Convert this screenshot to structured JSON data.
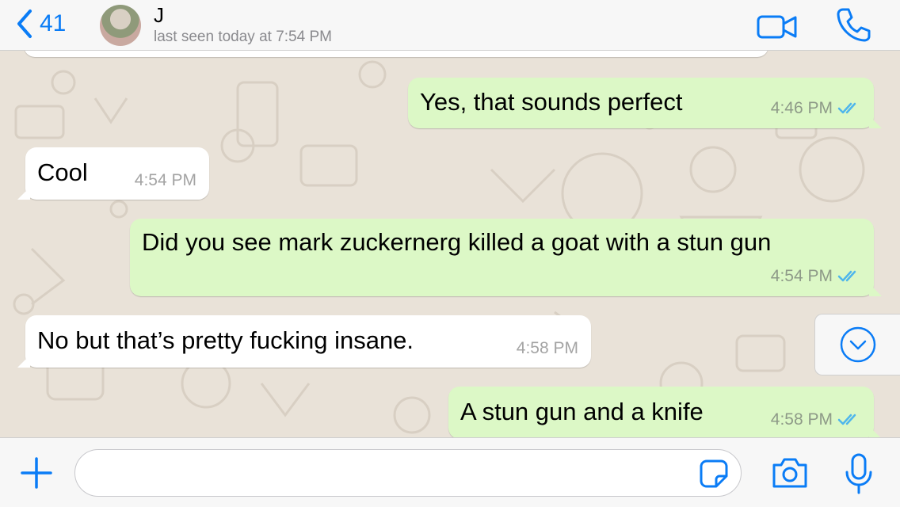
{
  "header": {
    "back_count": "41",
    "contact_name": "J",
    "last_seen": "last seen today at 7:54 PM"
  },
  "messages": [
    {
      "direction": "out",
      "text": "Yes, that sounds perfect",
      "time": "4:46 PM",
      "status": "read"
    },
    {
      "direction": "in",
      "text": "Cool",
      "time": "4:54 PM"
    },
    {
      "direction": "out",
      "text": "Did you see mark zuckernerg killed a goat with a stun gun",
      "time": "4:54 PM",
      "status": "read"
    },
    {
      "direction": "in",
      "text": "No but that’s pretty fucking insane.",
      "time": "4:58 PM"
    },
    {
      "direction": "out",
      "text": "A stun gun and a knife",
      "time": "4:58 PM",
      "status": "read"
    }
  ],
  "composer": {
    "message_value": "",
    "message_placeholder": ""
  },
  "icons": {
    "back": "chevron-left-icon",
    "video": "video-call-icon",
    "phone": "phone-icon",
    "scroll": "chevron-down-circle-icon",
    "plus": "plus-icon",
    "sticker": "sticker-icon",
    "camera": "camera-icon",
    "mic": "microphone-icon"
  },
  "colors": {
    "accent": "#0a7cf6",
    "outgoing_bubble": "#dcf8c6",
    "incoming_bubble": "#ffffff",
    "read_ticks": "#4fb6ec",
    "wallpaper": "#e9e2d8"
  }
}
